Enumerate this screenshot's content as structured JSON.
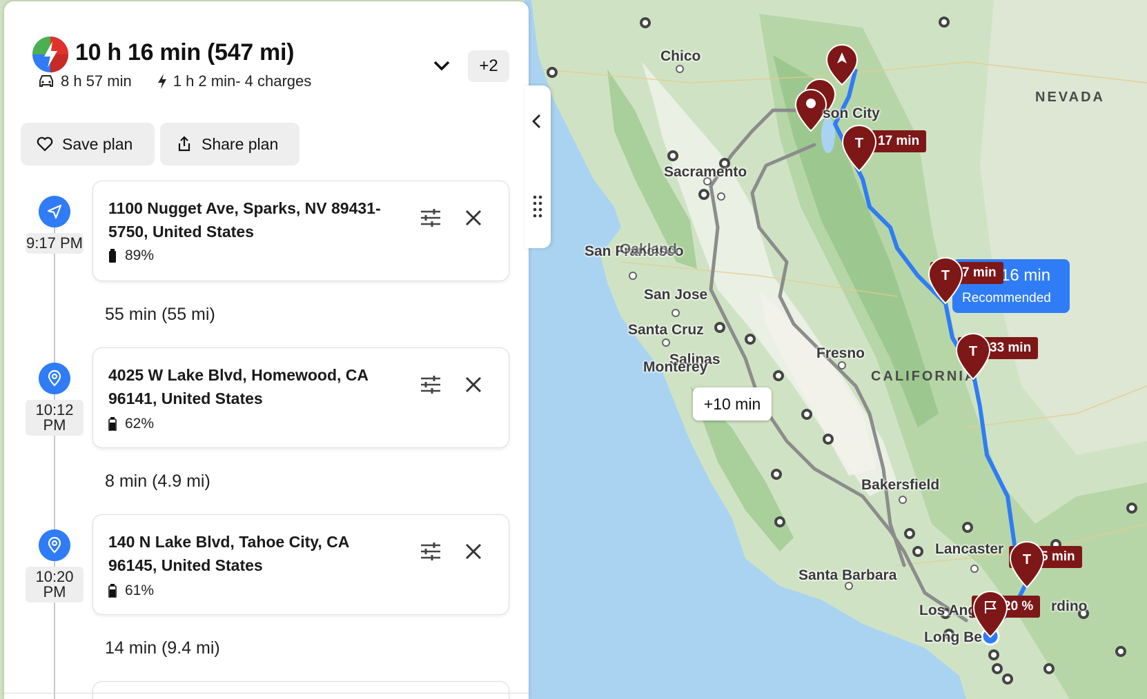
{
  "summary": {
    "title": "10 h 16 min (547 mi)",
    "drive_time": "8 h 57 min",
    "charge_time": "1 h 2 min- 4 charges",
    "more_label": "+2"
  },
  "actions": {
    "save_label": "Save plan",
    "share_label": "Share plan"
  },
  "stops": [
    {
      "time": "9:17 PM",
      "address": "1100 Nugget Ave, Sparks, NV 89431-5750, United States",
      "battery": "89%"
    },
    {
      "time": "10:12 PM",
      "address": "4025 W Lake Blvd, Homewood, CA 96141, United States",
      "battery": "62%"
    },
    {
      "time": "10:20 PM",
      "address": "140 N Lake Blvd, Tahoe City, CA 96145, United States",
      "battery": "61%"
    }
  ],
  "legs": [
    "55 min (55 mi)",
    "8 min (4.9 mi)",
    "14 min (9.4 mi)"
  ],
  "map": {
    "cities": [
      "Chico",
      "Sacramento",
      "San Francisco",
      "Oakland",
      "San Jose",
      "Santa Cruz",
      "Salinas",
      "Monterey",
      "Fresno",
      "Bakersfield",
      "Lancaster",
      "Santa Barbara",
      "Los Ang",
      "Long Be",
      "son City",
      "rdino"
    ],
    "states": [
      "NEVADA",
      "CALIFORNIA"
    ],
    "charger_chips": [
      "17 min",
      "7 min",
      "33 min",
      "5 min",
      "20 %"
    ],
    "route_bubble": {
      "time": "16 min",
      "label": "Recommended"
    },
    "alt_route": "+10 min"
  },
  "colors": {
    "accent": "#2f7cf6",
    "marker": "#7e1717",
    "water": "#aad3f2",
    "land": "#cfe3c4"
  }
}
